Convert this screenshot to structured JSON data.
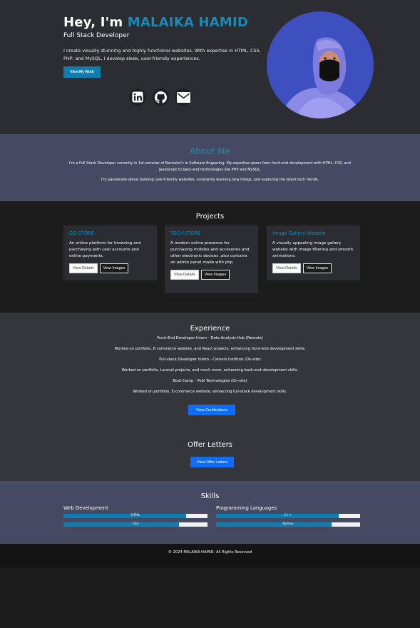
{
  "hero": {
    "greeting": "Hey, I'm",
    "name": "MALAIKA HAMID",
    "role": "Full Stack Developer",
    "intro": "I create visually stunning and highly functional websites. With expertise in HTML, CSS, PHP, and MySQL, I develop sleek, user-friendly experiences.",
    "view_work_label": "View My Work",
    "social_icons": [
      "linkedin-icon",
      "github-icon",
      "envelope-icon"
    ]
  },
  "about": {
    "title": "About Me",
    "paragraph1": "I'm a Full Stack Developer currently in 1st-semster of Bachelor's in Software Engeering. My expertise spans from front-end development with HTML, CSS, and JavaScript to back-end technologies like PHP and MySQL.",
    "paragraph2": "I'm passionate about building user-friendly websites, constantly learning new things, and exploring the latest tech trends."
  },
  "projects": {
    "title": "Projects",
    "items": [
      {
        "title": "GO-STORE",
        "description": "An online platform for browsing and purchasing with user accounts and online payments.",
        "details_label": "View Details",
        "images_label": "View Images"
      },
      {
        "title": "TECH-STORE",
        "description": "A modern online presence for purchasing mobiles and accesories and other electronic devices ,also contains an admin panel made with php.",
        "details_label": "View Details",
        "images_label": "View Images"
      },
      {
        "title": "Image Gallery Website",
        "description": "A visually appealing image gallery website with image filtering and smooth animations.",
        "details_label": "View Details",
        "images_label": "View Images"
      }
    ]
  },
  "experience": {
    "title": "Experience",
    "lines": [
      "Front-End Developer Intern - Data Analysis Hub (Remote)",
      "Worked on portfolio, E-commerce website, and React projects, enhancing front-end development skills.",
      "Full-stack Developer Intern - Careers Institute (On-site)",
      "Worked on portfolio, Laravel projects, and much more, enhancing back-end development skills.",
      "Boot-Camp - Pebi Technologies (On-site)",
      "Worked on portfolio, E-commerce website, enhancing full-stack development skills."
    ],
    "certifications_label": "View Certifications",
    "offer_title": "Offer Letters",
    "offer_label": "View Offer Letters"
  },
  "skills": {
    "title": "Skills",
    "web_title": "Web Development",
    "prog_title": "Programming Languages",
    "web": [
      {
        "name": "HTML",
        "level": 0.85
      },
      {
        "name": "CSS",
        "level": 0.8
      }
    ],
    "prog": [
      {
        "name": "C++",
        "level": 0.85
      },
      {
        "name": "Python",
        "level": 0.8
      }
    ]
  },
  "footer": {
    "text": "© 2024 MALAIKA HAMID- All Rights Reserved"
  },
  "colors": {
    "accent": "#1a8ab5",
    "button_blue": "#0d6efd",
    "bar_fill": "#0f7db0"
  }
}
